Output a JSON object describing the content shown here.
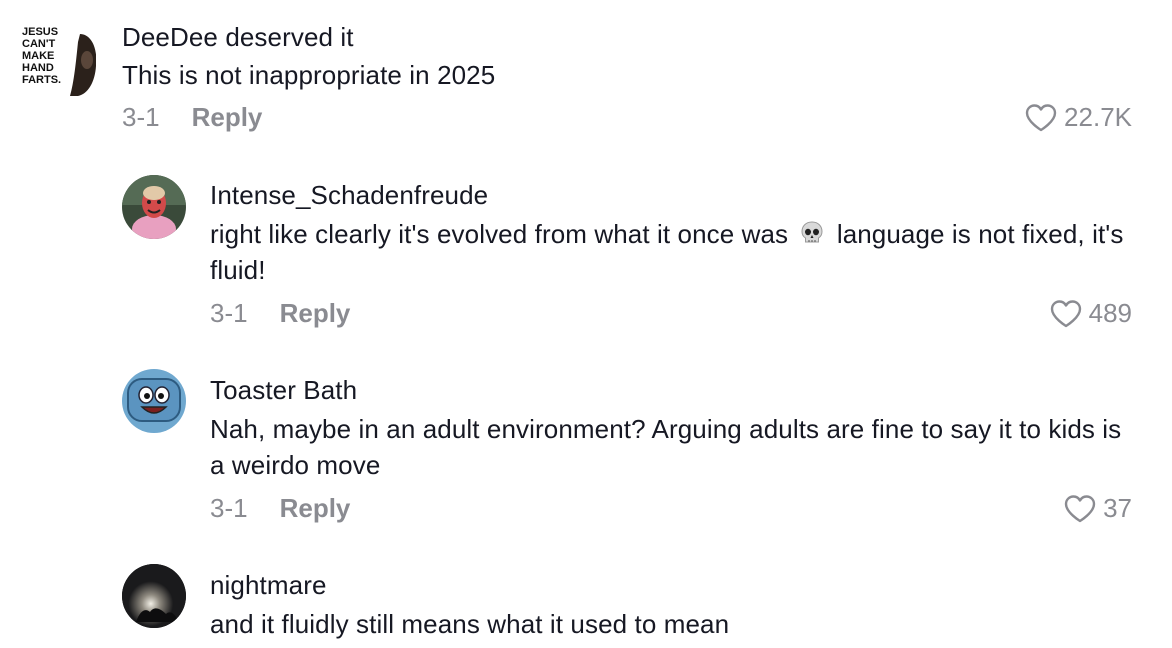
{
  "comments": [
    {
      "username": "DeeDee deserved it",
      "avatar_text": [
        "JESUS",
        "CAN'T",
        "MAKE",
        "HAND",
        "FARTS."
      ],
      "text": "This is not inappropriate in 2025",
      "date": "3-1",
      "reply_label": "Reply",
      "likes": "22.7K"
    },
    {
      "username": "Intense_Schadenfreude",
      "text_before_emoji": "right like clearly it's evolved from what it once was",
      "emoji": "skull-emoji",
      "text_after_emoji": "language is not fixed, it's fluid!",
      "date": "3-1",
      "reply_label": "Reply",
      "likes": "489"
    },
    {
      "username": "Toaster Bath",
      "text": "Nah, maybe in an adult environment? Arguing adults are fine to say it to kids is a weirdo move",
      "date": "3-1",
      "reply_label": "Reply",
      "likes": "37"
    },
    {
      "username": "nightmare",
      "text": "and it fluidly still means what it used to mean"
    }
  ],
  "colors": {
    "text_primary": "#161823",
    "text_secondary": "#8a8b91",
    "background": "#ffffff"
  },
  "icons": {
    "like": "heart-outline-icon"
  }
}
